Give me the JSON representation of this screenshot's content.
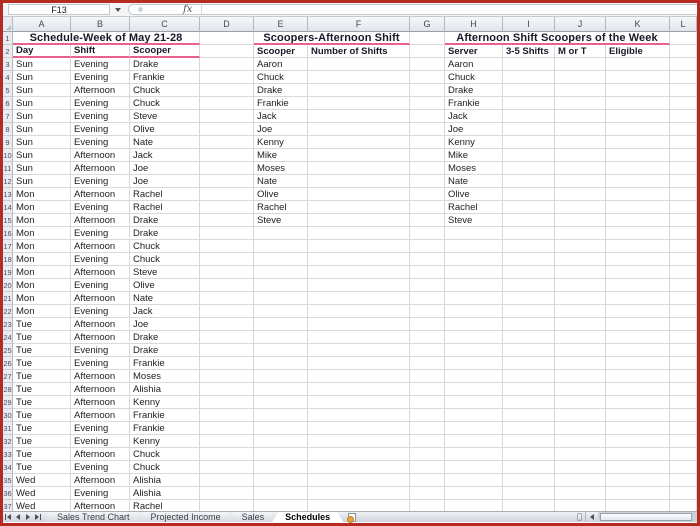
{
  "formula_bar": {
    "name_box": "F13",
    "fx_label": "fx",
    "formula_value": ""
  },
  "grid": {
    "column_headers": [
      "A",
      "B",
      "C",
      "D",
      "E",
      "F",
      "G",
      "H",
      "I",
      "J",
      "K",
      "L"
    ],
    "row_count": 37
  },
  "sections": {
    "schedule": {
      "title": "Schedule-Week of May 21-28",
      "headers": [
        "Day",
        "Shift",
        "Scooper"
      ],
      "rows": [
        [
          "Sun",
          "Evening",
          "Drake"
        ],
        [
          "Sun",
          "Evening",
          "Frankie"
        ],
        [
          "Sun",
          "Afternoon",
          "Chuck"
        ],
        [
          "Sun",
          "Evening",
          "Chuck"
        ],
        [
          "Sun",
          "Evening",
          "Steve"
        ],
        [
          "Sun",
          "Evening",
          "Olive"
        ],
        [
          "Sun",
          "Evening",
          "Nate"
        ],
        [
          "Sun",
          "Afternoon",
          "Jack"
        ],
        [
          "Sun",
          "Afternoon",
          "Joe"
        ],
        [
          "Sun",
          "Evening",
          "Joe"
        ],
        [
          "Mon",
          "Afternoon",
          "Rachel"
        ],
        [
          "Mon",
          "Evening",
          "Rachel"
        ],
        [
          "Mon",
          "Afternoon",
          "Drake"
        ],
        [
          "Mon",
          "Evening",
          "Drake"
        ],
        [
          "Mon",
          "Afternoon",
          "Chuck"
        ],
        [
          "Mon",
          "Evening",
          "Chuck"
        ],
        [
          "Mon",
          "Afternoon",
          "Steve"
        ],
        [
          "Mon",
          "Evening",
          "Olive"
        ],
        [
          "Mon",
          "Afternoon",
          "Nate"
        ],
        [
          "Mon",
          "Evening",
          "Jack"
        ],
        [
          "Tue",
          "Afternoon",
          "Joe"
        ],
        [
          "Tue",
          "Afternoon",
          "Drake"
        ],
        [
          "Tue",
          "Evening",
          "Drake"
        ],
        [
          "Tue",
          "Evening",
          "Frankie"
        ],
        [
          "Tue",
          "Afternoon",
          "Moses"
        ],
        [
          "Tue",
          "Afternoon",
          "Alishia"
        ],
        [
          "Tue",
          "Afternoon",
          "Kenny"
        ],
        [
          "Tue",
          "Afternoon",
          "Frankie"
        ],
        [
          "Tue",
          "Evening",
          "Frankie"
        ],
        [
          "Tue",
          "Evening",
          "Kenny"
        ],
        [
          "Tue",
          "Afternoon",
          "Chuck"
        ],
        [
          "Tue",
          "Evening",
          "Chuck"
        ],
        [
          "Wed",
          "Afternoon",
          "Alishia"
        ],
        [
          "Wed",
          "Evening",
          "Alishia"
        ],
        [
          "Wed",
          "Afternoon",
          "Rachel"
        ]
      ]
    },
    "shift_count": {
      "title": "Scoopers-Afternoon Shift",
      "headers": [
        "Scooper",
        "Number of Shifts"
      ],
      "scoopers": [
        "Aaron",
        "Chuck",
        "Drake",
        "Frankie",
        "Jack",
        "Joe",
        "Kenny",
        "Mike",
        "Moses",
        "Nate",
        "Olive",
        "Rachel",
        "Steve"
      ]
    },
    "eligibility": {
      "title": "Afternoon Shift Scoopers of the Week",
      "headers": [
        "Server",
        "3-5 Shifts",
        "M or T",
        "Eligible"
      ],
      "servers": [
        "Aaron",
        "Chuck",
        "Drake",
        "Frankie",
        "Jack",
        "Joe",
        "Kenny",
        "Mike",
        "Moses",
        "Nate",
        "Olive",
        "Rachel",
        "Steve"
      ]
    }
  },
  "sheet_tabs": {
    "tabs": [
      {
        "label": "Sales Trend Chart",
        "active": false
      },
      {
        "label": "Projected Income",
        "active": false
      },
      {
        "label": "Sales",
        "active": false
      },
      {
        "label": "Schedules",
        "active": true
      }
    ]
  },
  "colors": {
    "window_border": "#b52b22",
    "accent_pink": "#e7608e"
  }
}
